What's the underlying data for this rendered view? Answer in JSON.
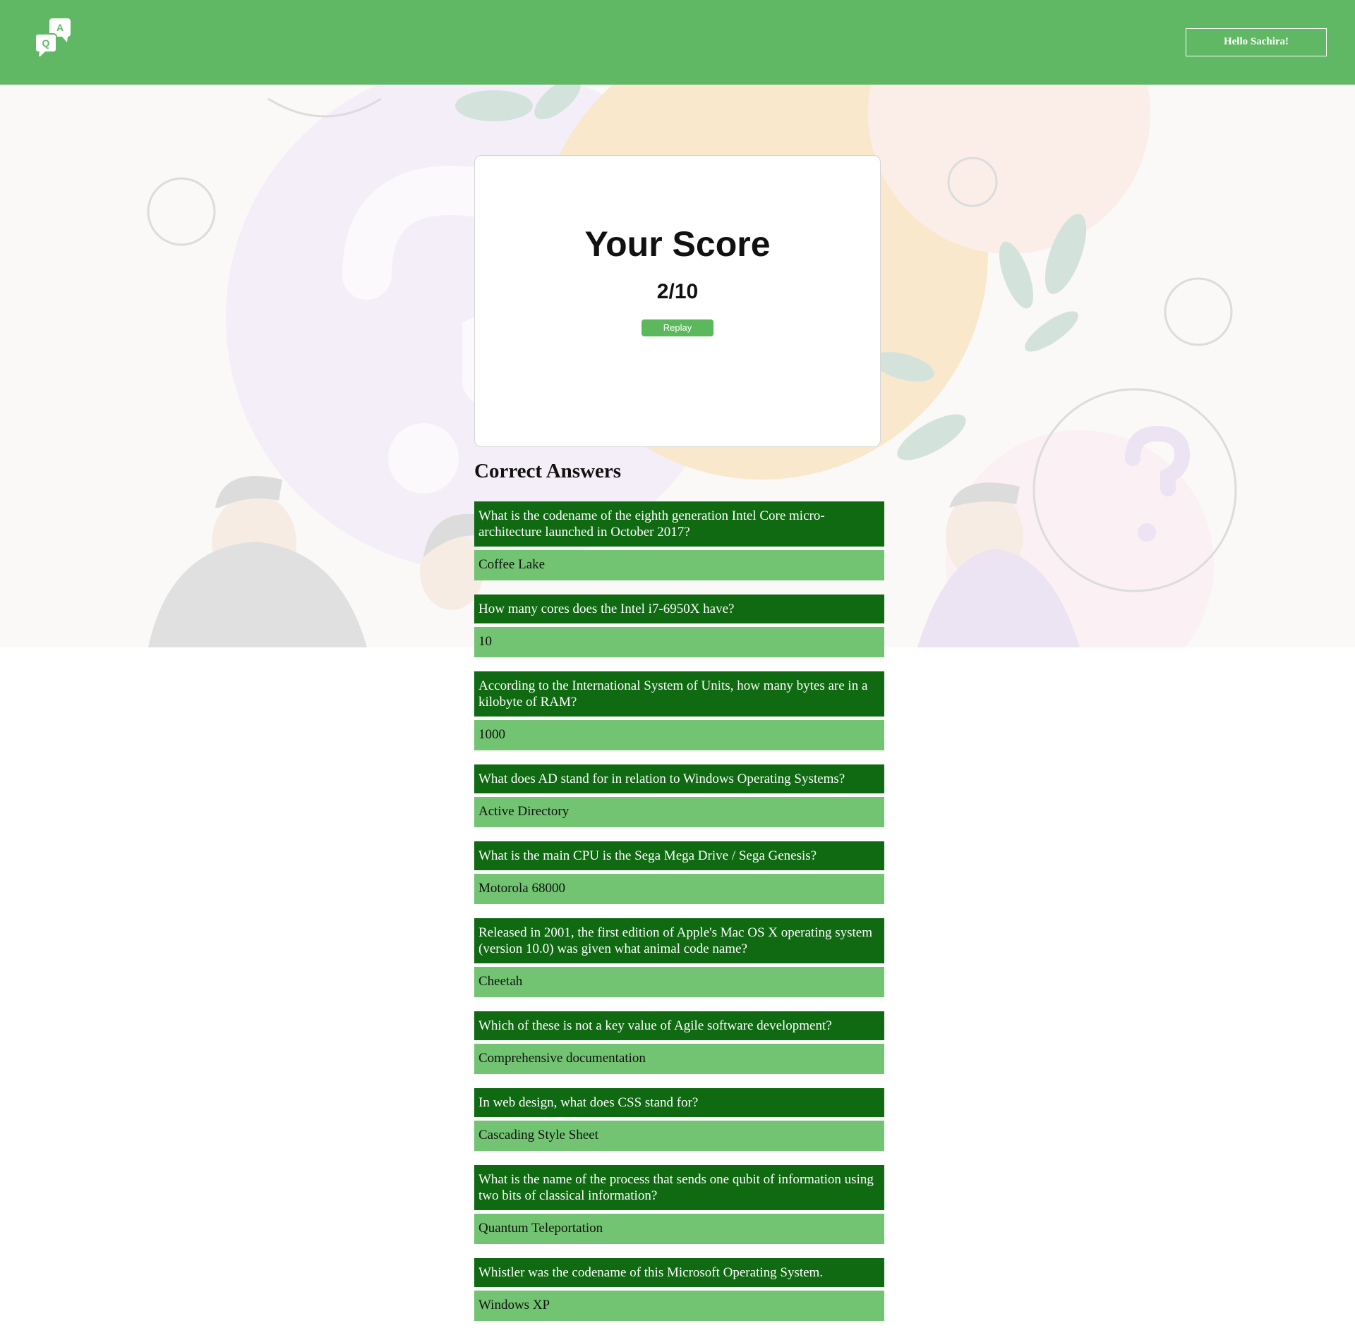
{
  "header": {
    "logo_letters": {
      "a": "A",
      "q": "Q"
    },
    "greeting": "Hello Sachira!",
    "background_color": "#60b864"
  },
  "score": {
    "title": "Your Score",
    "value": "2/10",
    "replay_label": "Replay"
  },
  "answers": {
    "heading": "Correct Answers",
    "items": [
      {
        "question": "What is the codename of the eighth generation Intel Core micro-architecture launched in October 2017?",
        "answer": "Coffee Lake"
      },
      {
        "question": "How many cores does the Intel i7-6950X have?",
        "answer": "10"
      },
      {
        "question": "According to the International System of Units, how many bytes are in a kilobyte of RAM?",
        "answer": "1000"
      },
      {
        "question": "What does AD stand for in relation to Windows Operating Systems?",
        "answer": "Active Directory"
      },
      {
        "question": "What is the main CPU is the Sega Mega Drive / Sega Genesis?",
        "answer": "Motorola 68000"
      },
      {
        "question": "Released in 2001, the first edition of Apple's Mac OS X operating system (version 10.0) was given what animal code name?",
        "answer": "Cheetah"
      },
      {
        "question": "Which of these is not a key value of Agile software development?",
        "answer": "Comprehensive documentation"
      },
      {
        "question": "In web design, what does CSS stand for?",
        "answer": "Cascading Style Sheet"
      },
      {
        "question": "What is the name of the process that sends one qubit of information using two bits of classical information?",
        "answer": "Quantum Teleportation"
      },
      {
        "question": "Whistler was the codename of this Microsoft Operating System.",
        "answer": "Windows XP"
      }
    ]
  },
  "colors": {
    "question_bg": "#0f6a12",
    "answer_bg": "#72c472",
    "accent": "#5cb85c"
  }
}
